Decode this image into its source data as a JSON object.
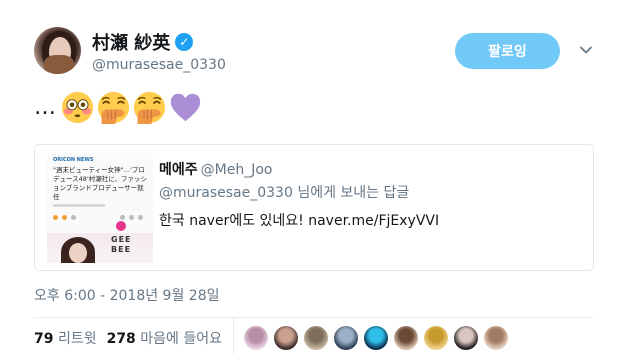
{
  "author": {
    "display_name": "村瀬 紗英",
    "verified_mark": "✓",
    "handle": "@murasesae_0330"
  },
  "follow_button": {
    "label": "팔로잉"
  },
  "tweet": {
    "text": "…",
    "emojis": [
      "flushed-face",
      "face-with-hand-over-mouth",
      "face-with-hand-over-mouth",
      "purple-heart"
    ]
  },
  "quoted_tweet": {
    "thumbnail": {
      "tag": "ORICON NEWS",
      "lines": [
        "\"週末ビューティー女神\"…'プロ",
        "デュース48'村瀬社に、ファッシ",
        "ョンブランドプロデューサー就",
        "任"
      ],
      "brand_text_1": "GEE",
      "brand_text_2": "BEE"
    },
    "author_name": "메에주",
    "author_handle": "@Meh_Joo",
    "reply_mention": "@murasesae_0330",
    "reply_suffix": "님에게 보내는 답글",
    "body": "한국 naver에도 있네요! naver.me/FjExyVVI"
  },
  "timestamp": "오후 6:00 - 2018년 9월 28일",
  "stats": {
    "retweets_count": "79",
    "retweets_label": "리트윗",
    "likes_count": "278",
    "likes_label": "마음에 들어요"
  },
  "likers": [
    {
      "colors": [
        "#e9d6e2",
        "#b78fa6"
      ]
    },
    {
      "colors": [
        "#3b2a27",
        "#caa090"
      ]
    },
    {
      "colors": [
        "#c6b7a3",
        "#7d6e5c"
      ]
    },
    {
      "colors": [
        "#2d3d52",
        "#9bb0c6"
      ]
    },
    {
      "colors": [
        "#0b2a4a",
        "#2fc0e8"
      ]
    },
    {
      "colors": [
        "#d8c3ae",
        "#6b4a36"
      ]
    },
    {
      "colors": [
        "#f1d28a",
        "#c79a2d"
      ]
    },
    {
      "colors": [
        "#1f1a1c",
        "#d9c4c0"
      ]
    },
    {
      "colors": [
        "#e8d3c2",
        "#a07c63"
      ]
    }
  ],
  "colors": {
    "accent": "#1da1f2",
    "follow_button_bg": "#71c9f8",
    "secondary_text": "#657786"
  }
}
